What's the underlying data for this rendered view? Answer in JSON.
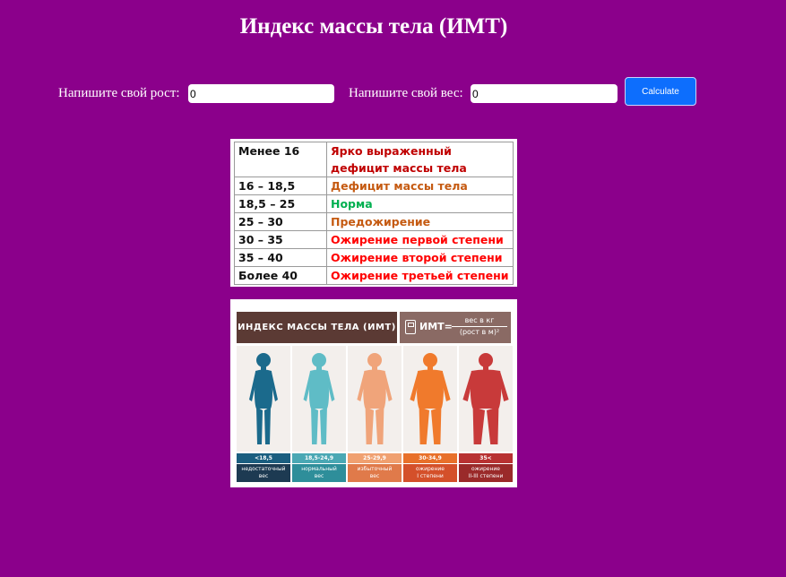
{
  "page": {
    "title": "Индекс массы тела (ИМТ)"
  },
  "form": {
    "height_label": "Напишите свой рост:",
    "height_value": "0",
    "weight_label": "Напишите свой вес:",
    "weight_value": "0",
    "calculate_label": "Calculate"
  },
  "bmi_table": {
    "rows": [
      {
        "range": "Менее 16",
        "category": "Ярко выраженный дефицит массы тела",
        "color": "#c00000"
      },
      {
        "range": "16 – 18,5",
        "category": "Дефицит массы тела",
        "color": "#c55a11"
      },
      {
        "range": "18,5 – 25",
        "category": "Норма",
        "color": "#00b050"
      },
      {
        "range": "25 – 30",
        "category": "Предожирение",
        "color": "#c55a11"
      },
      {
        "range": "30 – 35",
        "category": "Ожирение первой степени",
        "color": "#ff0000"
      },
      {
        "range": "35 – 40",
        "category": "Ожирение второй степени",
        "color": "#ff0000"
      },
      {
        "range": "Более 40",
        "category": "Ожирение третьей степени",
        "color": "#ff0000"
      }
    ]
  },
  "infographic": {
    "header_title": "ИНДЕКС МАССЫ ТЕЛА (ИМТ)",
    "formula_label": "ИМТ=",
    "formula_numerator": "вес в кг",
    "formula_denominator": "(рост в м)²",
    "columns": [
      {
        "range": "<18,5",
        "category_line1": "недостаточный",
        "category_line2": "вес",
        "figure_color": "#1b6a8c",
        "band_color": "#1b5e80",
        "label_color": "#1d3a52"
      },
      {
        "range": "18,5-24,9",
        "category_line1": "нормальный",
        "category_line2": "вес",
        "figure_color": "#5fbcc6",
        "band_color": "#4aa8b4",
        "label_color": "#2e8e9a"
      },
      {
        "range": "25-29,9",
        "category_line1": "избыточный",
        "category_line2": "вес",
        "figure_color": "#f0a47a",
        "band_color": "#f0a070",
        "label_color": "#e07a4a"
      },
      {
        "range": "30-34,9",
        "category_line1": "ожирение",
        "category_line2": "I степени",
        "figure_color": "#f07a2c",
        "band_color": "#e8702a",
        "label_color": "#d4502a"
      },
      {
        "range": "35<",
        "category_line1": "ожирение",
        "category_line2": "II-III степени",
        "figure_color": "#c83a3a",
        "band_color": "#b83232",
        "label_color": "#9a2a2a"
      }
    ]
  }
}
